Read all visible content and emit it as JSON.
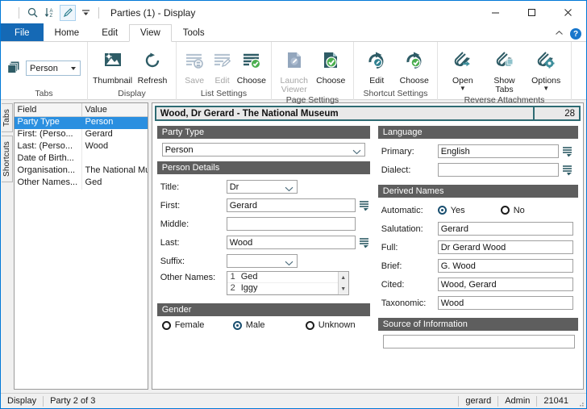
{
  "window": {
    "title": "Parties (1) - Display",
    "quick_access": [
      {
        "name": "search-icon",
        "label": "Search"
      },
      {
        "name": "sort-icon",
        "label": "Sort"
      },
      {
        "name": "edit-pencil-icon",
        "label": "Edit"
      },
      {
        "name": "customize-qat-icon",
        "label": "Customize Quick Access Toolbar"
      }
    ],
    "controls": {
      "minimize": "Minimize",
      "maximize": "Maximize",
      "close": "Close"
    },
    "ribbon_collapse": "Collapse Ribbon",
    "help": "?"
  },
  "menu": {
    "tabs": [
      {
        "label": "File",
        "kind": "file"
      },
      {
        "label": "Home",
        "kind": "normal"
      },
      {
        "label": "Edit",
        "kind": "normal"
      },
      {
        "label": "View",
        "kind": "selected"
      },
      {
        "label": "Tools",
        "kind": "normal"
      }
    ]
  },
  "ribbon": {
    "groups": [
      {
        "label": "Tabs",
        "combo": {
          "value": "Person",
          "placeholder": "Person"
        },
        "icon": "tabs-stack-icon",
        "buttons": []
      },
      {
        "label": "Display",
        "buttons": [
          {
            "label": "Thumbnail",
            "icon": "thumbnail-image-icon",
            "disabled": false,
            "caret": false
          },
          {
            "label": "Refresh",
            "icon": "refresh-circular-arrow-icon",
            "disabled": false,
            "caret": false
          }
        ]
      },
      {
        "label": "List Settings",
        "buttons": [
          {
            "label": "Save",
            "icon": "list-save-icon",
            "disabled": true,
            "caret": false
          },
          {
            "label": "Edit",
            "icon": "list-edit-icon",
            "disabled": true,
            "caret": false
          },
          {
            "label": "Choose",
            "icon": "list-choose-check-icon",
            "disabled": false,
            "caret": false
          }
        ]
      },
      {
        "label": "Page Settings",
        "buttons": [
          {
            "label": "Launch Viewer",
            "icon": "page-launch-viewer-icon",
            "disabled": true,
            "caret": false
          },
          {
            "label": "Choose",
            "icon": "page-choose-check-icon",
            "disabled": false,
            "caret": false
          }
        ]
      },
      {
        "label": "Shortcut Settings",
        "buttons": [
          {
            "label": "Edit",
            "icon": "shortcut-edit-icon",
            "disabled": false,
            "caret": false
          },
          {
            "label": "Choose",
            "icon": "shortcut-choose-check-icon",
            "disabled": false,
            "caret": false
          }
        ]
      },
      {
        "label": "Reverse Attachments",
        "buttons": [
          {
            "label": "Open",
            "icon": "paperclip-open-icon",
            "disabled": false,
            "caret": true
          },
          {
            "label": "Show Tabs",
            "icon": "paperclip-tabs-icon",
            "disabled": false,
            "caret": false
          },
          {
            "label": "Options",
            "icon": "paperclip-options-icon",
            "disabled": false,
            "caret": true
          }
        ]
      }
    ]
  },
  "sidetabs": [
    {
      "label": "Tabs"
    },
    {
      "label": "Shortcuts"
    }
  ],
  "left_panel": {
    "columns": [
      "Field",
      "Value"
    ],
    "rows": [
      {
        "field": "Party Type",
        "value": "Person",
        "selected": true
      },
      {
        "field": "First: (Perso...",
        "value": "Gerard",
        "selected": false
      },
      {
        "field": "Last: (Perso...",
        "value": "Wood",
        "selected": false
      },
      {
        "field": "Date of Birth...",
        "value": "",
        "selected": false
      },
      {
        "field": "Organisation...",
        "value": "The National Museum",
        "selected": false
      },
      {
        "field": "Other Names...",
        "value": "Ged",
        "selected": false
      }
    ]
  },
  "record": {
    "title": "Wood, Dr Gerard - The National Museum",
    "count": "28"
  },
  "form": {
    "party_type": {
      "section": "Party Type",
      "value": "Person"
    },
    "person_details": {
      "section": "Person Details",
      "fields": [
        {
          "label": "Title:",
          "value": "Dr",
          "type": "select",
          "lookup": false,
          "width": 88
        },
        {
          "label": "First:",
          "value": "Gerard",
          "type": "text",
          "lookup": true,
          "width": 160
        },
        {
          "label": "Middle:",
          "value": "",
          "type": "text",
          "lookup": false,
          "width": 160
        },
        {
          "label": "Last:",
          "value": "Wood",
          "type": "text",
          "lookup": true,
          "width": 160
        },
        {
          "label": "Suffix:",
          "value": "",
          "type": "select",
          "lookup": false,
          "width": 88
        }
      ],
      "other_names": {
        "label": "Other Names:",
        "items": [
          {
            "n": "1",
            "value": "Ged"
          },
          {
            "n": "2",
            "value": "Iggy"
          }
        ]
      }
    },
    "gender": {
      "section": "Gender",
      "options": [
        {
          "label": "Female",
          "selected": false
        },
        {
          "label": "Male",
          "selected": true
        },
        {
          "label": "Unknown",
          "selected": false
        }
      ]
    },
    "language": {
      "section": "Language",
      "fields": [
        {
          "label": "Primary:",
          "value": "English",
          "lookup": true
        },
        {
          "label": "Dialect:",
          "value": "",
          "lookup": true
        }
      ]
    },
    "derived_names": {
      "section": "Derived Names",
      "automatic": {
        "label": "Automatic:",
        "options": [
          {
            "label": "Yes",
            "selected": true
          },
          {
            "label": "No",
            "selected": false
          }
        ]
      },
      "fields": [
        {
          "label": "Salutation:",
          "value": "Gerard"
        },
        {
          "label": "Full:",
          "value": "Dr Gerard Wood"
        },
        {
          "label": "Brief:",
          "value": "G. Wood"
        },
        {
          "label": "Cited:",
          "value": "Wood, Gerard"
        },
        {
          "label": "Taxonomic:",
          "value": "Wood"
        }
      ]
    },
    "source_of_information": {
      "section": "Source of Information",
      "value": ""
    }
  },
  "statusbar": {
    "mode": "Display",
    "position": "Party 2 of 3",
    "user": "gerard",
    "role": "Admin",
    "id": "21041"
  },
  "colors": {
    "accent": "#1569b5",
    "record_border": "#2e6b73",
    "section_header": "#5e5e5e",
    "selection": "#2a8fe0",
    "icon_dark_teal": "#2e5c66",
    "icon_green": "#4caf50"
  }
}
